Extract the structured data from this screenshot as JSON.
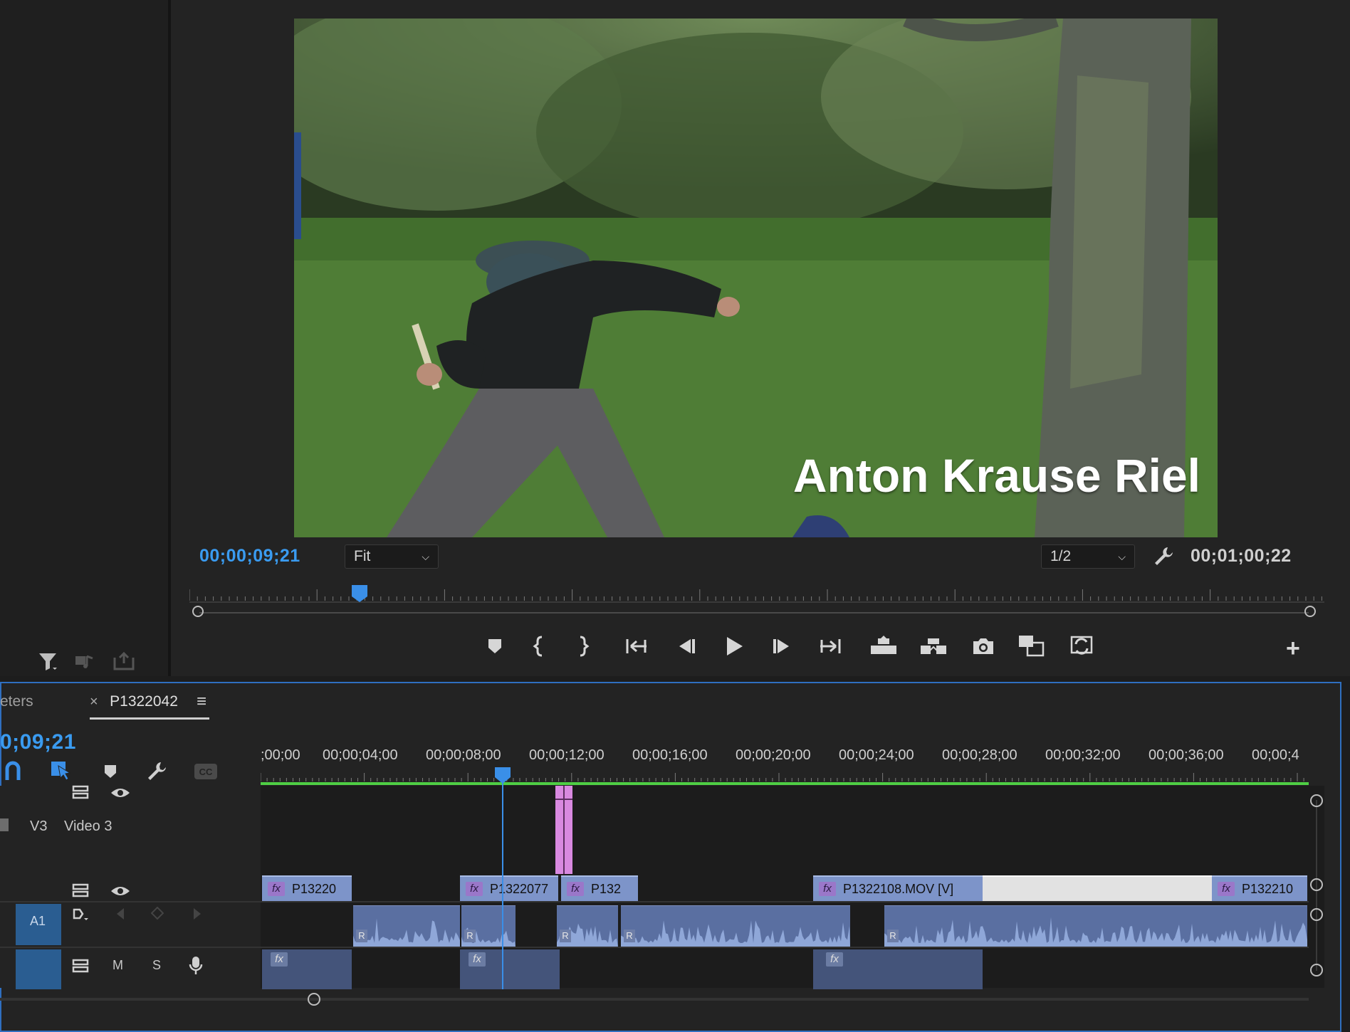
{
  "project_panel": {
    "icons": [
      "filter-icon",
      "automate-to-sequence-icon",
      "export-icon"
    ]
  },
  "program_monitor": {
    "playhead_timecode": "00;00;09;21",
    "zoom_select": "Fit",
    "resolution_select": "1/2",
    "duration_timecode": "00;01;00;22",
    "title_overlay": "Anton Krause Riel",
    "playhead_position": 0.15,
    "transport_controls": [
      "add-marker-icon",
      "mark-in-icon",
      "mark-out-icon",
      "go-to-in-icon",
      "step-back-icon",
      "play-icon",
      "step-forward-icon",
      "go-to-out-icon",
      "lift-icon",
      "extract-icon",
      "export-frame-icon",
      "comparison-view-icon",
      "toggle-proxies-icon"
    ],
    "add_button": "+"
  },
  "timeline": {
    "tabs": [
      {
        "label": "eters",
        "close": ""
      },
      {
        "label": "P1322042",
        "close": "×",
        "menu": "≡"
      }
    ],
    "current_timecode": "0;09;21",
    "ruler_labels": [
      ";00;00",
      "00;00;04;00",
      "00;00;08;00",
      "00;00;12;00",
      "00;00;16;00",
      "00;00;20;00",
      "00;00;24;00",
      "00;00;28;00",
      "00;00;32;00",
      "00;00;36;00",
      "00;00;4"
    ],
    "tracks": {
      "v3": {
        "id": "V3",
        "name": "Video 3"
      },
      "a1": {
        "id": "A1"
      },
      "a2": {
        "mute": "M",
        "solo": "S"
      }
    },
    "v2_clips": [
      {
        "label": "P13220"
      },
      {
        "label": "P1322077"
      },
      {
        "label": "P132"
      },
      {
        "label": "P1322108.MOV [V]"
      },
      {
        "label": "P132210"
      }
    ],
    "audio_badge": "R",
    "fx_badge": "fx"
  }
}
